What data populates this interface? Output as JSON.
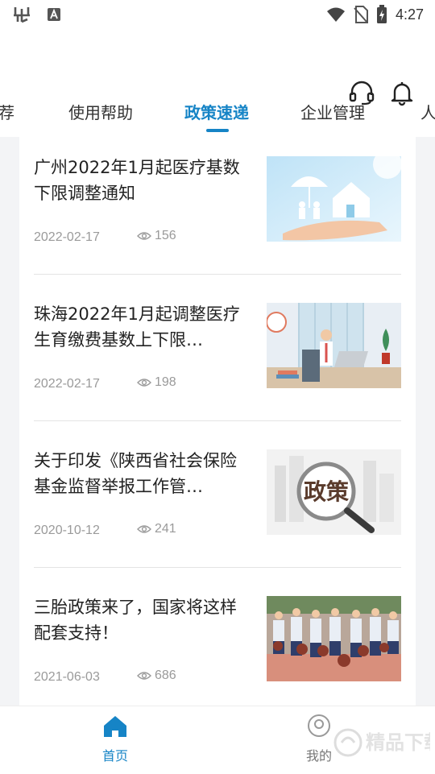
{
  "statusbar": {
    "time": "4:27",
    "app_icons": [
      "bug-icon",
      "a-icon"
    ],
    "system_icons": [
      "wifi-icon",
      "no-sim-icon",
      "battery-charging-icon"
    ]
  },
  "header": {
    "icons": [
      "headset-icon",
      "bell-icon"
    ]
  },
  "tabs": [
    {
      "label": "推荐",
      "visible_text": "荐",
      "active": false
    },
    {
      "label": "使用帮助",
      "active": false
    },
    {
      "label": "政策速递",
      "active": true
    },
    {
      "label": "企业管理",
      "active": false
    },
    {
      "label": "人",
      "active": false
    }
  ],
  "articles": [
    {
      "title": "广州2022年1月起医疗基数下限调整通知",
      "date": "2022-02-17",
      "views": "156",
      "thumb": "insurance-house-umbrella-image"
    },
    {
      "title": "珠海2022年1月起调整医疗生育缴费基数上下限…",
      "date": "2022-02-17",
      "views": "198",
      "thumb": "office-worker-illustration-image"
    },
    {
      "title": "关于印发《陕西省社会保险基金监督举报工作管…",
      "date": "2020-10-12",
      "views": "241",
      "thumb": "policy-magnifier-image"
    },
    {
      "title": "三胎政策来了，国家将这样配套支持！",
      "date": "2021-06-03",
      "views": "686",
      "thumb": "children-basketball-image"
    }
  ],
  "bottom_nav": [
    {
      "label": "首页",
      "icon": "home-icon",
      "active": true
    },
    {
      "label": "我的",
      "icon": "user-icon",
      "active": false
    }
  ],
  "colors": {
    "accent": "#1684c6",
    "muted": "#9a9a9a",
    "divider": "#e4e4e4",
    "background": "#f3f4f6"
  }
}
